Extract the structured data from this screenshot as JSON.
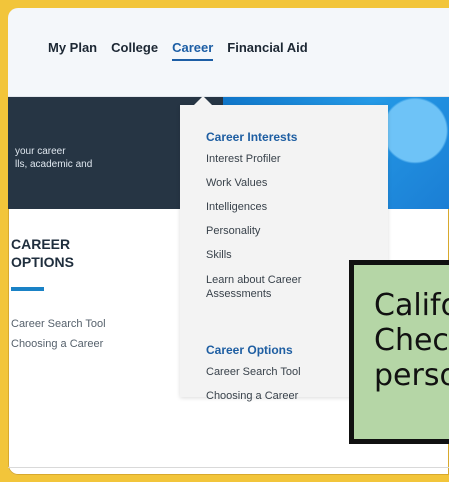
{
  "nav": {
    "items": [
      {
        "label": "My Plan"
      },
      {
        "label": "College"
      },
      {
        "label": "Career",
        "active": true
      },
      {
        "label": "Financial Aid"
      }
    ]
  },
  "hero": {
    "text_line_1": "your career",
    "text_line_2": "lls, academic and"
  },
  "section": {
    "title_line_1": "CAREER",
    "title_line_2": "OPTIONS",
    "links": [
      "Career Search Tool",
      "Choosing a Career"
    ]
  },
  "dropdown": {
    "groups": [
      {
        "heading": "Career Interests",
        "items": [
          "Interest Profiler",
          "Work Values",
          "Intelligences",
          "Personality",
          "Skills",
          "Learn about Career",
          "Assessments"
        ]
      },
      {
        "heading": "Career Options",
        "items": [
          "Career Search Tool",
          "Choosing a Career"
        ]
      }
    ]
  },
  "callout": {
    "lines": [
      "Califo",
      "Chec",
      "perso"
    ]
  },
  "colors": {
    "accent": "#1c5ea5",
    "background": "#f2c53a",
    "callout": "#b5d6a6"
  }
}
